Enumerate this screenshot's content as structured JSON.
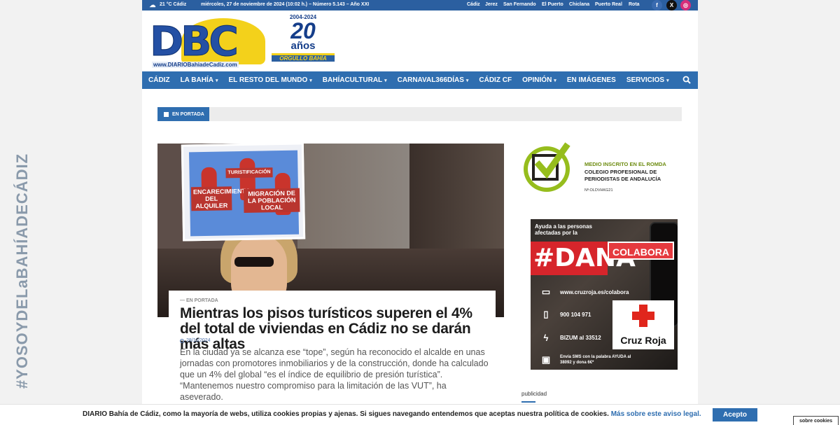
{
  "side": {
    "vertical_text": "#YOSOYDELaBAHÍADECÁDIZ"
  },
  "topbar": {
    "weather": "21 °C  Cádiz",
    "date_line": "miércoles, 27 de noviembre de 2024 (10:02 h.) – Número 5.143 – Año XXI",
    "links": [
      "Cádiz",
      "Jerez",
      "San Fernando",
      "El Puerto",
      "Chiclana",
      "Puerto Real",
      "Rota"
    ],
    "social": [
      "facebook-icon",
      "x-icon",
      "instagram-icon"
    ]
  },
  "logo": {
    "brand": "DBC",
    "url": "www.DIARIOBahiadeCadiz.com"
  },
  "anniversary": {
    "years": "2004-2024",
    "number": "20",
    "word": "años",
    "motto": "ORGULLO BAHÍA"
  },
  "nav": {
    "items": [
      {
        "label": "CÁDIZ",
        "dropdown": false
      },
      {
        "label": "LA BAHÍA",
        "dropdown": true
      },
      {
        "label": "EL RESTO DEL MUNDO",
        "dropdown": true
      },
      {
        "label": "BAHÍACULTURAL",
        "dropdown": true
      },
      {
        "label": "CARNAVAL366DÍAS",
        "dropdown": true
      },
      {
        "label": "CÁDIZ CF",
        "dropdown": false
      },
      {
        "label": "OPINIÓN",
        "dropdown": true
      },
      {
        "label": "EN IMÁGENES",
        "dropdown": false
      },
      {
        "label": "SERVICIOS",
        "dropdown": true
      }
    ]
  },
  "section": {
    "label": "EN PORTADA"
  },
  "hero": {
    "placard_top": "TURISTIFICACIÓN",
    "placard_left": "ENCARECIMIENTO DEL ALQUILER",
    "placard_right": "MIGRACIÓN DE LA POBLACIÓN LOCAL"
  },
  "article": {
    "kicker": "— EN PORTADA",
    "title": "Mientras los pisos turísticos superen el 4% del total de viviendas en Cádiz no se darán más altas",
    "date": "28/11/2024",
    "excerpt": "En la ciudad ya se alcanza ese “tope”, según ha reconocido el alcalde en unas jornadas con promotores inmobiliarios y de la construcción, donde ha calculado que un 4% del global “es el índice de equilibrio de presión turística”. “Mantenemos nuestro compromiso para la limitación de las VUT”, ha aseverado."
  },
  "romda": {
    "line1": "MEDIO INSCRITO EN EL ROMDA",
    "line2": "COLEGIO PROFESIONAL DE PERIODISTAS DE ANDALUCÍA",
    "line3": "Nº:OLDVHKG21"
  },
  "dana_ad": {
    "intro": "Ayuda a las personas afectadas por la",
    "hashtag": "#DANA",
    "colabora": "COLABORA",
    "web": "www.cruzroja.es/colabora",
    "phone": "900 104 971",
    "bizum": "BIZUM al 33512",
    "sms": "Envía SMS con la palabra AYUDA al 38092 y dona 6€*",
    "org": "Cruz Roja"
  },
  "publicidad": "publicidad",
  "cookie": {
    "message": "DIARIO Bahía de Cádiz, como la mayoría de webs, utiliza cookies propias y ajenas. Si sigues navegando entendemos que aceptas nuestra política de cookies.",
    "link": "Más sobre este aviso legal.",
    "accept": "Acepto",
    "about": "sobre cookies"
  },
  "colors": {
    "brand_blue": "#2f6eb0",
    "top_bar": "#2b5fa0",
    "romda_green": "#96bd1d",
    "dana_red": "#d6252b"
  }
}
